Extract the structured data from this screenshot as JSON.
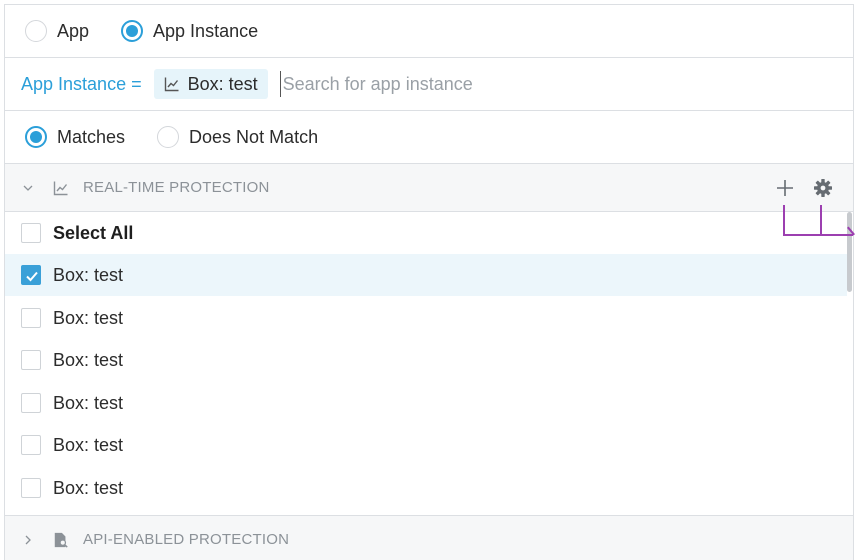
{
  "scope": {
    "options": [
      {
        "label": "App",
        "selected": false
      },
      {
        "label": "App Instance",
        "selected": true
      }
    ]
  },
  "filter": {
    "key_label": "App Instance =",
    "chip_label": "Box: test",
    "chip_icon": "line-chart-icon",
    "search_placeholder": "Search for app instance"
  },
  "match": {
    "options": [
      {
        "label": "Matches",
        "selected": true
      },
      {
        "label": "Does Not Match",
        "selected": false
      }
    ]
  },
  "sections": [
    {
      "title": "REAL-TIME PROTECTION",
      "expanded": true,
      "icon": "line-chart-icon",
      "actions": [
        "plus-icon",
        "gear-icon"
      ]
    },
    {
      "title": "API-ENABLED PROTECTION",
      "expanded": false,
      "icon": "document-search-icon"
    }
  ],
  "list": {
    "select_all_label": "Select All",
    "items": [
      {
        "label": "Box: test",
        "checked": true
      },
      {
        "label": "Box: test",
        "checked": false
      },
      {
        "label": "Box: test",
        "checked": false
      },
      {
        "label": "Box: test",
        "checked": false
      },
      {
        "label": "Box: test",
        "checked": false
      },
      {
        "label": "Box: test",
        "checked": false
      }
    ]
  },
  "colors": {
    "accent": "#2b9fd9",
    "selected_row": "#ecf6fb",
    "connector": "#9c3fb0"
  }
}
